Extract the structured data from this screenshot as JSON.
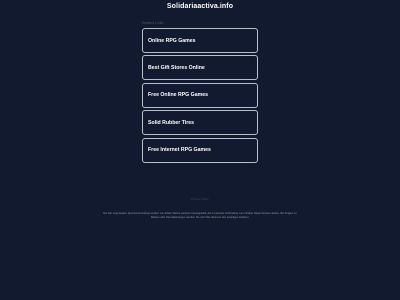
{
  "header": {
    "domain": "Solidariaactiva.info"
  },
  "related": {
    "label": "Related Links",
    "links": [
      {
        "label": "Online RPG Games"
      },
      {
        "label": "Best Gift Stores Online"
      },
      {
        "label": "Free Online RPG Games"
      },
      {
        "label": "Solid Rubber Tires"
      },
      {
        "label": "Free Internet RPG Games"
      }
    ]
  },
  "footer": {
    "privacy": "Privacy Policy",
    "disclaimer": "Die hier angezeigten Sponsored Listings werden von dritten Werbe-partnern bereitgestellt, die in keinerlei Verbindung zum Inhaber dieser Domain stehen. Bei Fragen zu Marken oder Dienstleistungen wenden Sie sich bitte direkt an den jeweiligen Anbieter."
  }
}
